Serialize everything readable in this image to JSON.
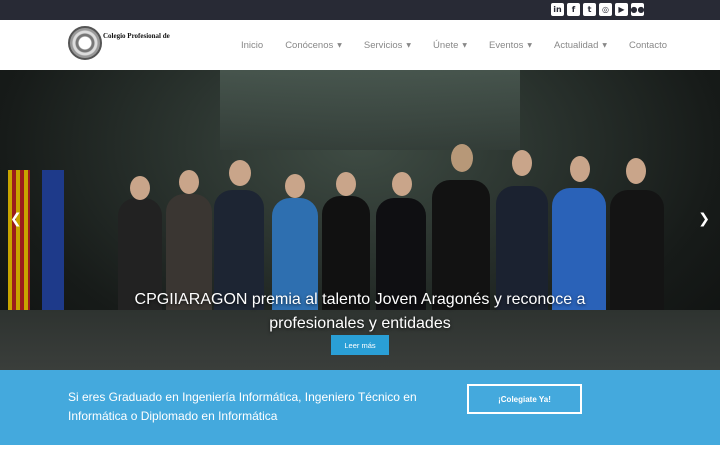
{
  "topbar": {
    "social": [
      {
        "icon": "linkedin-icon",
        "glyph": "in"
      },
      {
        "icon": "facebook-icon",
        "glyph": "f"
      },
      {
        "icon": "twitter-icon",
        "glyph": "t"
      },
      {
        "icon": "instagram-icon",
        "glyph": "◎"
      },
      {
        "icon": "youtube-icon",
        "glyph": "▶"
      },
      {
        "icon": "flickr-icon",
        "glyph": "●●"
      }
    ]
  },
  "header": {
    "logo_text": "Colegio Profesional de",
    "menu": [
      {
        "label": "Inicio",
        "dropdown": false
      },
      {
        "label": "Conócenos",
        "dropdown": true
      },
      {
        "label": "Servicios",
        "dropdown": true
      },
      {
        "label": "Únete",
        "dropdown": true
      },
      {
        "label": "Eventos",
        "dropdown": true
      },
      {
        "label": "Actualidad",
        "dropdown": true
      },
      {
        "label": "Contacto",
        "dropdown": false
      }
    ]
  },
  "hero": {
    "caption": "CPGIIARAGON premia al talento Joven Aragonés y reconoce a profesionales y entidades",
    "button_label": "Leer más",
    "prev_glyph": "❮",
    "next_glyph": "❯"
  },
  "cta": {
    "text": "Si eres Graduado en Ingeniería Informática, Ingeniero Técnico en Informática o Diplomado en Informática",
    "button_label": "¡Colegiate Ya!"
  },
  "colors": {
    "topbar": "#282a35",
    "accent": "#2a9fd6",
    "cta_band": "#44a9dd"
  }
}
